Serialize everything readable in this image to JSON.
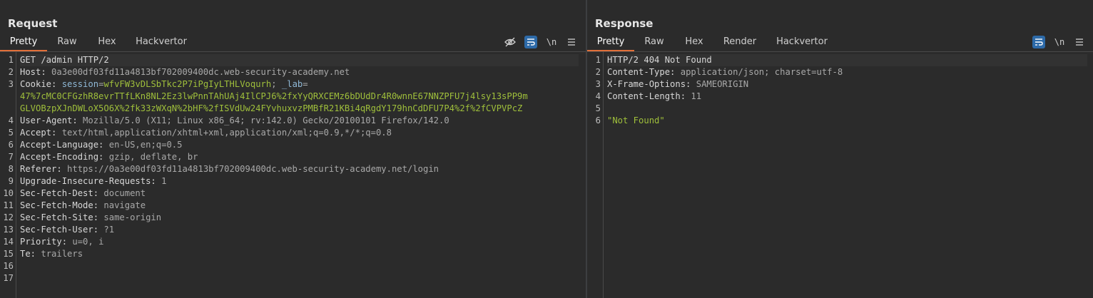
{
  "request": {
    "title": "Request",
    "tabs": [
      "Pretty",
      "Raw",
      "Hex",
      "Hackvertor"
    ],
    "active_tab": "Pretty",
    "icons": [
      "hide-icon",
      "wrap-icon",
      "newline-icon",
      "menu-icon"
    ],
    "newline_label": "\\n",
    "line_numbers": [
      "1",
      "2",
      "3",
      "",
      "",
      "4",
      "5",
      "6",
      "7",
      "8",
      "9",
      "10",
      "11",
      "12",
      "13",
      "14",
      "15",
      "16",
      "17"
    ],
    "lines": {
      "l1": "GET /admin HTTP/2",
      "l2k": "Host:",
      "l2v": " 0a3e00df03fd11a4813bf702009400dc.web-security-academy.net",
      "l3k": "Cookie:",
      "l3a": " session",
      "l3b": "=",
      "l3c": "wfvFW3vDLSbTkc2P7iPgIyLTHLVoqurh",
      "l3d": "; ",
      "l3e": "_lab",
      "l3f": "=",
      "l3w1": "47%7cMC0CFGzhR8evrTTfLKn8NL2Ez3lwPnnTAhUAj4IlCPJ6%2fxYyQRXCEMz6bDUdDr4R0wnnE67NNZPFU7j4lsy13sPP9m",
      "l3w2": "GLVOBzpXJnDWLoX5O6X%2fk33zWXqN%2bHF%2fISVdUw24FYvhuxvzPMBfR21KBi4qRgdY179hnCdDFU7P4%2f%2fCVPVPcZ",
      "l4k": "User-Agent:",
      "l4v": " Mozilla/5.0 (X11; Linux x86_64; rv:142.0) Gecko/20100101 Firefox/142.0",
      "l5k": "Accept:",
      "l5v": " text/html,application/xhtml+xml,application/xml;q=0.9,*/*;q=0.8",
      "l6k": "Accept-Language:",
      "l6v": " en-US,en;q=0.5",
      "l7k": "Accept-Encoding:",
      "l7v": " gzip, deflate, br",
      "l8k": "Referer:",
      "l8v": " https://0a3e00df03fd11a4813bf702009400dc.web-security-academy.net/login",
      "l9k": "Upgrade-Insecure-Requests:",
      "l9v": " 1",
      "l10k": "Sec-Fetch-Dest:",
      "l10v": " document",
      "l11k": "Sec-Fetch-Mode:",
      "l11v": " navigate",
      "l12k": "Sec-Fetch-Site:",
      "l12v": " same-origin",
      "l13k": "Sec-Fetch-User:",
      "l13v": " ?1",
      "l14k": "Priority:",
      "l14v": " u=0, i",
      "l15k": "Te:",
      "l15v": " trailers"
    }
  },
  "response": {
    "title": "Response",
    "tabs": [
      "Pretty",
      "Raw",
      "Hex",
      "Render",
      "Hackvertor"
    ],
    "active_tab": "Pretty",
    "icons": [
      "wrap-icon",
      "newline-icon",
      "menu-icon"
    ],
    "newline_label": "\\n",
    "line_numbers": [
      "1",
      "2",
      "3",
      "4",
      "5",
      "6"
    ],
    "lines": {
      "l1": "HTTP/2 404 Not Found",
      "l2k": "Content-Type:",
      "l2v": " application/json; charset=utf-8",
      "l3k": "X-Frame-Options:",
      "l3v": " SAMEORIGIN",
      "l4k": "Content-Length:",
      "l4v": " 11",
      "l6": "\"Not Found\""
    }
  },
  "layout_buttons": [
    "split-vertical-icon",
    "split-horizontal-icon",
    "single-pane-icon"
  ],
  "colors": {
    "background": "#2b2b2b",
    "accent_tab": "#e2703a",
    "toggle_on": "#2d6aa8",
    "value_green": "#9fbf3b",
    "cookie_name_blue": "#8fb8d6"
  }
}
